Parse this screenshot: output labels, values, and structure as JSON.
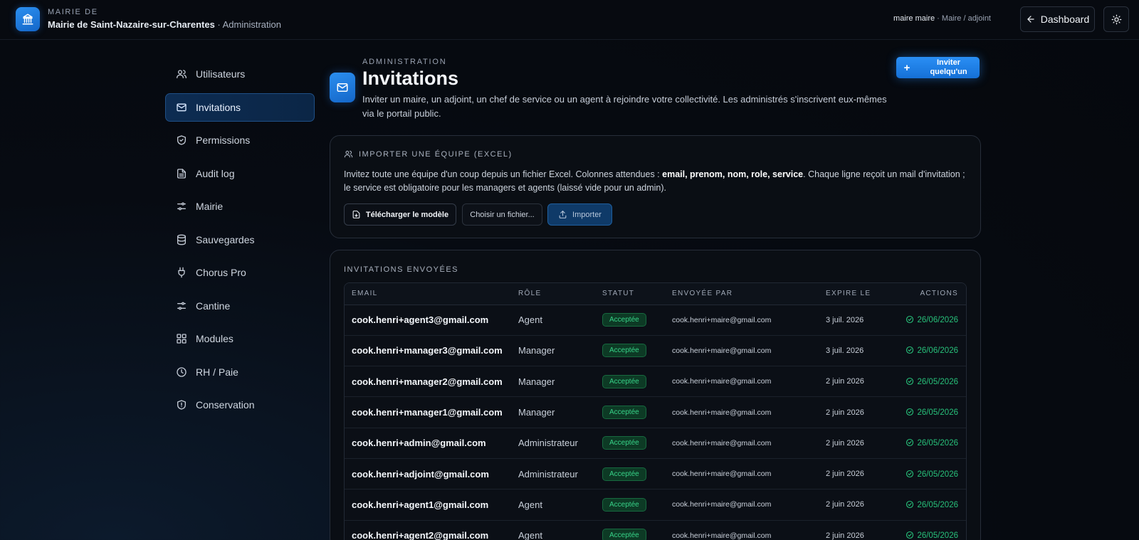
{
  "header": {
    "kicker": "MAIRIE DE",
    "org_name": "Mairie de Saint-Nazaire-sur-Charentes",
    "org_suffix": " · Administration",
    "user_name": "maire maire",
    "user_role": " · Maire / adjoint",
    "dashboard_label": "Dashboard"
  },
  "sidebar": {
    "items": [
      {
        "label": "Utilisateurs",
        "icon": "users-icon"
      },
      {
        "label": "Invitations",
        "icon": "mail-icon",
        "active": true
      },
      {
        "label": "Permissions",
        "icon": "shield-check-icon"
      },
      {
        "label": "Audit log",
        "icon": "file-text-icon"
      },
      {
        "label": "Mairie",
        "icon": "sliders-icon"
      },
      {
        "label": "Sauvegardes",
        "icon": "database-icon"
      },
      {
        "label": "Chorus Pro",
        "icon": "plug-icon"
      },
      {
        "label": "Cantine",
        "icon": "sliders-icon"
      },
      {
        "label": "Modules",
        "icon": "grid-icon"
      },
      {
        "label": "RH / Paie",
        "icon": "clock-icon"
      },
      {
        "label": "Conservation",
        "icon": "shield-alert-icon"
      }
    ]
  },
  "page": {
    "kicker": "ADMINISTRATION",
    "title": "Invitations",
    "description": "Inviter un maire, un adjoint, un chef de service ou un agent à rejoindre votre collectivité. Les administrés s'inscrivent eux-mêmes via le portail public.",
    "invite_button": "Inviter quelqu'un"
  },
  "import": {
    "heading": "IMPORTER UNE ÉQUIPE (EXCEL)",
    "text_before": "Invitez toute une équipe d'un coup depuis un fichier Excel. Colonnes attendues : ",
    "text_columns": "email, prenom, nom, role, service",
    "text_after": ". Chaque ligne reçoit un mail d'invitation ; le service est obligatoire pour les managers et agents (laissé vide pour un admin).",
    "download_label": "Télécharger le modèle",
    "file_label": "Choisir un fichier...",
    "import_label": "Importer"
  },
  "sent": {
    "heading": "INVITATIONS ENVOYÉES",
    "columns": [
      "EMAIL",
      "RÔLE",
      "STATUT",
      "ENVOYÉE PAR",
      "EXPIRE LE",
      "ACTIONS"
    ],
    "rows": [
      {
        "email": "cook.henri+agent3@gmail.com",
        "role": "Agent",
        "status": "Acceptée",
        "by": "cook.henri+maire@gmail.com",
        "expires": "3 juil. 2026",
        "action": "26/06/2026"
      },
      {
        "email": "cook.henri+manager3@gmail.com",
        "role": "Manager",
        "status": "Acceptée",
        "by": "cook.henri+maire@gmail.com",
        "expires": "3 juil. 2026",
        "action": "26/06/2026"
      },
      {
        "email": "cook.henri+manager2@gmail.com",
        "role": "Manager",
        "status": "Acceptée",
        "by": "cook.henri+maire@gmail.com",
        "expires": "2 juin 2026",
        "action": "26/05/2026"
      },
      {
        "email": "cook.henri+manager1@gmail.com",
        "role": "Manager",
        "status": "Acceptée",
        "by": "cook.henri+maire@gmail.com",
        "expires": "2 juin 2026",
        "action": "26/05/2026"
      },
      {
        "email": "cook.henri+admin@gmail.com",
        "role": "Administrateur",
        "status": "Acceptée",
        "by": "cook.henri+maire@gmail.com",
        "expires": "2 juin 2026",
        "action": "26/05/2026"
      },
      {
        "email": "cook.henri+adjoint@gmail.com",
        "role": "Administrateur",
        "status": "Acceptée",
        "by": "cook.henri+maire@gmail.com",
        "expires": "2 juin 2026",
        "action": "26/05/2026"
      },
      {
        "email": "cook.henri+agent1@gmail.com",
        "role": "Agent",
        "status": "Acceptée",
        "by": "cook.henri+maire@gmail.com",
        "expires": "2 juin 2026",
        "action": "26/05/2026"
      },
      {
        "email": "cook.henri+agent2@gmail.com",
        "role": "Agent",
        "status": "Acceptée",
        "by": "cook.henri+maire@gmail.com",
        "expires": "2 juin 2026",
        "action": "26/05/2026"
      }
    ]
  },
  "colors": {
    "accent": "#1f7fe6",
    "success": "#27c07a",
    "background": "#05080d"
  }
}
